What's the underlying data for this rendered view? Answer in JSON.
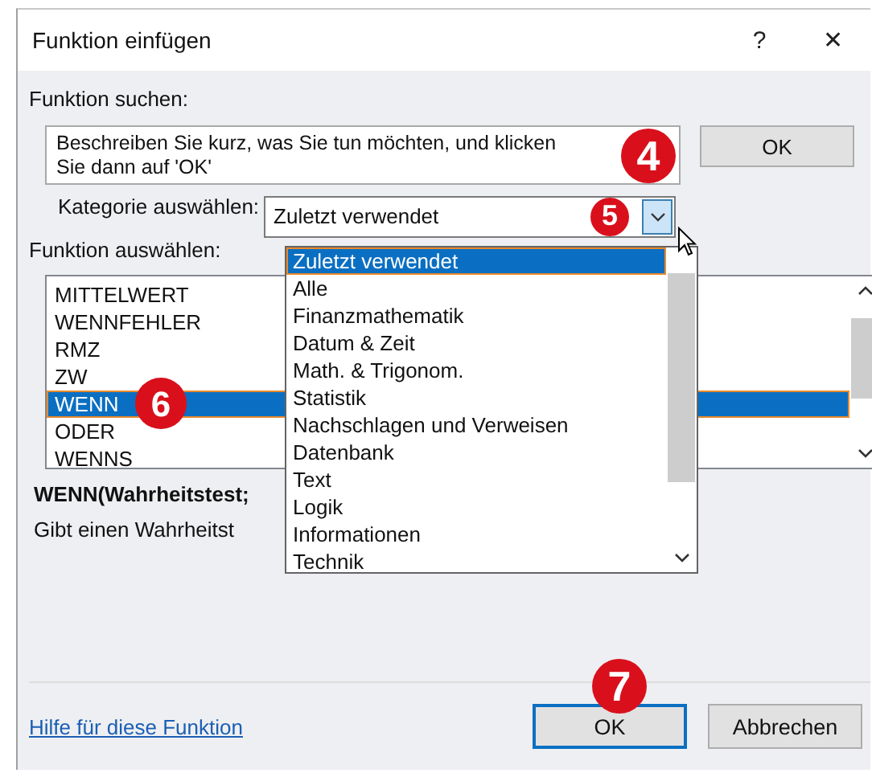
{
  "window": {
    "title": "Funktion einfügen",
    "help_button": "?",
    "close_button": "✕"
  },
  "search": {
    "label": "Funktion suchen:",
    "value": "Beschreiben Sie kurz, was Sie tun möchten, und klicken Sie dann auf 'OK'",
    "button": "OK"
  },
  "category": {
    "label": "Kategorie auswählen:",
    "value": "Zuletzt verwendet",
    "expanded": true,
    "options": [
      {
        "label": "Zuletzt verwendet",
        "selected": true
      },
      {
        "label": "Alle",
        "selected": false
      },
      {
        "label": "Finanzmathematik",
        "selected": false
      },
      {
        "label": "Datum & Zeit",
        "selected": false
      },
      {
        "label": "Math. & Trigonom.",
        "selected": false
      },
      {
        "label": "Statistik",
        "selected": false
      },
      {
        "label": "Nachschlagen und Verweisen",
        "selected": false
      },
      {
        "label": "Datenbank",
        "selected": false
      },
      {
        "label": "Text",
        "selected": false
      },
      {
        "label": "Logik",
        "selected": false
      },
      {
        "label": "Informationen",
        "selected": false
      },
      {
        "label": "Technik",
        "selected": false
      }
    ]
  },
  "functions": {
    "label": "Funktion auswählen:",
    "items": [
      {
        "label": "MITTELWERT",
        "selected": false
      },
      {
        "label": "WENNFEHLER",
        "selected": false
      },
      {
        "label": "RMZ",
        "selected": false
      },
      {
        "label": "ZW",
        "selected": false
      },
      {
        "label": "WENN",
        "selected": true
      },
      {
        "label": "ODER",
        "selected": false
      },
      {
        "label": "WENNS",
        "selected": false
      }
    ]
  },
  "syntax": "WENN(Wahrheitstest;",
  "description": "Gibt einen Wahrheitst",
  "help_link": "Hilfe für diese Funktion",
  "buttons": [
    {
      "label": "OK",
      "focused": true
    },
    {
      "label": "Abbrechen",
      "focused": false
    }
  ],
  "callouts": [
    "4",
    "5",
    "6",
    "7"
  ]
}
